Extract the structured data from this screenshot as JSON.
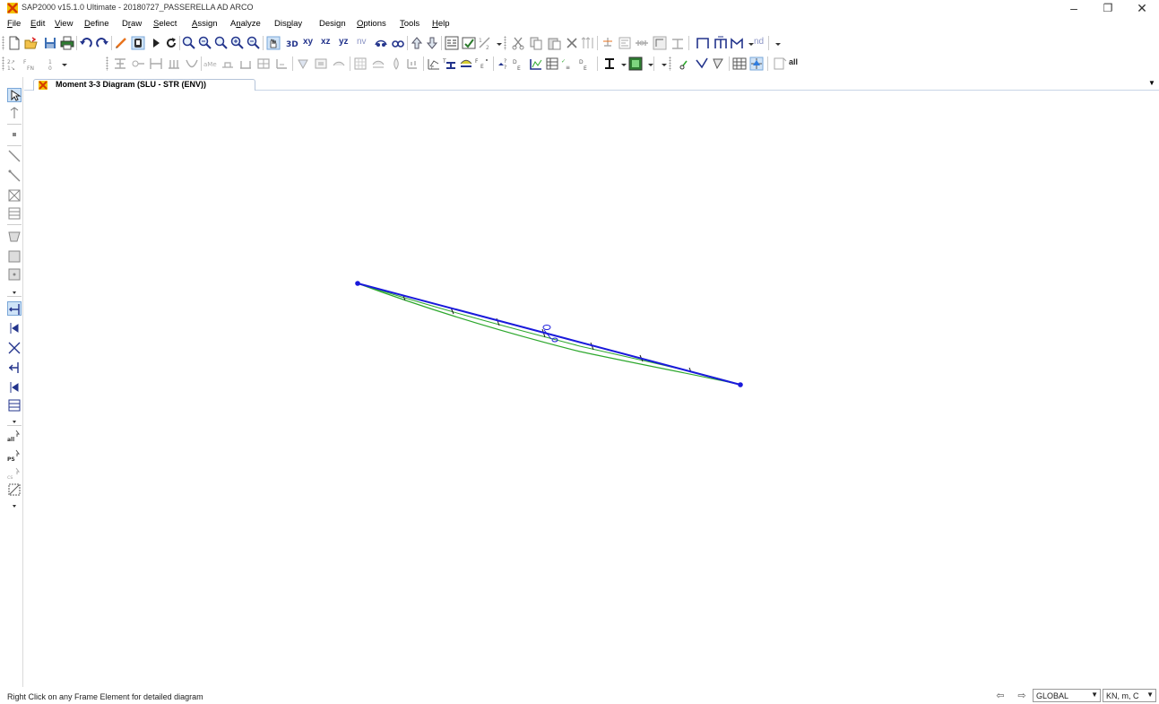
{
  "window": {
    "title": "SAP2000 v15.1.0 Ultimate  - 20180727_PASSERELLA AD ARCO",
    "minimize": "–",
    "maximize": "❐",
    "close": "✕"
  },
  "menu": {
    "items": [
      {
        "ul": "F",
        "rest": "ile"
      },
      {
        "ul": "E",
        "rest": "dit"
      },
      {
        "ul": "V",
        "rest": "iew"
      },
      {
        "ul": "D",
        "rest": "efine"
      },
      {
        "pre": "D",
        "ul": "r",
        "rest": "aw"
      },
      {
        "ul": "S",
        "rest": "elect"
      },
      {
        "ul": "A",
        "rest": "ssign"
      },
      {
        "pre": "A",
        "ul": "n",
        "rest": "alyze"
      },
      {
        "pre": "Dis",
        "ul": "p",
        "rest": "lay"
      },
      {
        "pre": "Desi",
        "ul": "g",
        "rest": "n"
      },
      {
        "ul": "O",
        "rest": "ptions"
      },
      {
        "ul": "T",
        "rest": "ools"
      },
      {
        "ul": "H",
        "rest": "elp"
      }
    ]
  },
  "toolbar": {
    "view_xy": "xy",
    "view_xz": "xz",
    "view_yz": "yz",
    "view_nv": "nv",
    "view_3d": "3D",
    "nd_label": "nd",
    "all_label": "all"
  },
  "left_toolbar": {
    "all_label": "all",
    "ps_label": "PS"
  },
  "tab": {
    "title": "Moment 3-3 Diagram  (SLU - STR (ENV))"
  },
  "status": {
    "message": "Right Click on any Frame Element for detailed diagram",
    "coord_system": "GLOBAL",
    "units": "KN, m, C"
  },
  "colors": {
    "frame_line": "#1a1adb",
    "moment_diagram": "#2ea82e",
    "accent_orange": "#e8731c"
  }
}
